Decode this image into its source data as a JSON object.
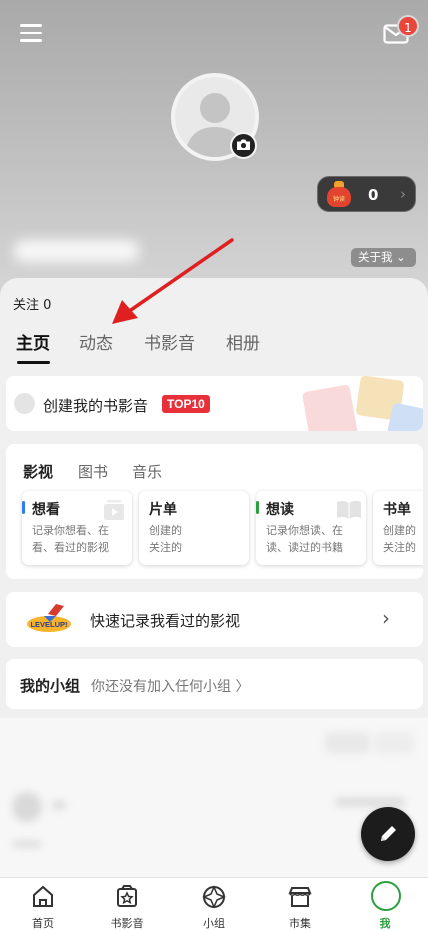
{
  "header": {
    "mail_badge_count": "1",
    "coin_bag_text": "钟读",
    "coin_count": "0",
    "about_me": "关于我"
  },
  "profile": {
    "follow_text": "关注 0"
  },
  "tabs": [
    {
      "label": "主页",
      "active": true
    },
    {
      "label": "动态",
      "active": false
    },
    {
      "label": "书影音",
      "active": false
    },
    {
      "label": "相册",
      "active": false
    }
  ],
  "create_card": {
    "label": "创建我的书影音",
    "badge": "TOP10"
  },
  "media": {
    "tabs": [
      "影视",
      "图书",
      "音乐"
    ],
    "cards": [
      {
        "title": "想看",
        "desc": "记录你想看、在看、看过的影视",
        "bar_color": "#2f7cf0",
        "icon": "video-play-icon"
      },
      {
        "title": "片单",
        "desc": "创建的关注的",
        "bar_color": "",
        "icon": ""
      },
      {
        "title": "想读",
        "desc": "记录你想读、在读、读过的书籍",
        "bar_color": "#2e9f3e",
        "icon": "open-book-icon"
      },
      {
        "title": "书单",
        "desc": "创建的关注的",
        "bar_color": "",
        "icon": ""
      }
    ]
  },
  "quick_record": {
    "badge_text": "LEVELUP!",
    "label": "快速记录我看过的影视"
  },
  "groups": {
    "label": "我的小组",
    "hint": "你还没有加入任何小组 〉"
  },
  "tabbar": [
    {
      "label": "首页",
      "icon": "home-icon",
      "active": false
    },
    {
      "label": "书影音",
      "icon": "media-star-icon",
      "active": false
    },
    {
      "label": "小组",
      "icon": "group-aperture-icon",
      "active": false
    },
    {
      "label": "市集",
      "icon": "market-store-icon",
      "active": false
    },
    {
      "label": "我",
      "icon": "me-icon",
      "active": true
    }
  ],
  "colors": {
    "accent_green": "#2e9f3e",
    "badge_red": "#e8463a",
    "top10_red": "#e8303a",
    "annotation_arrow": "#e02020"
  }
}
